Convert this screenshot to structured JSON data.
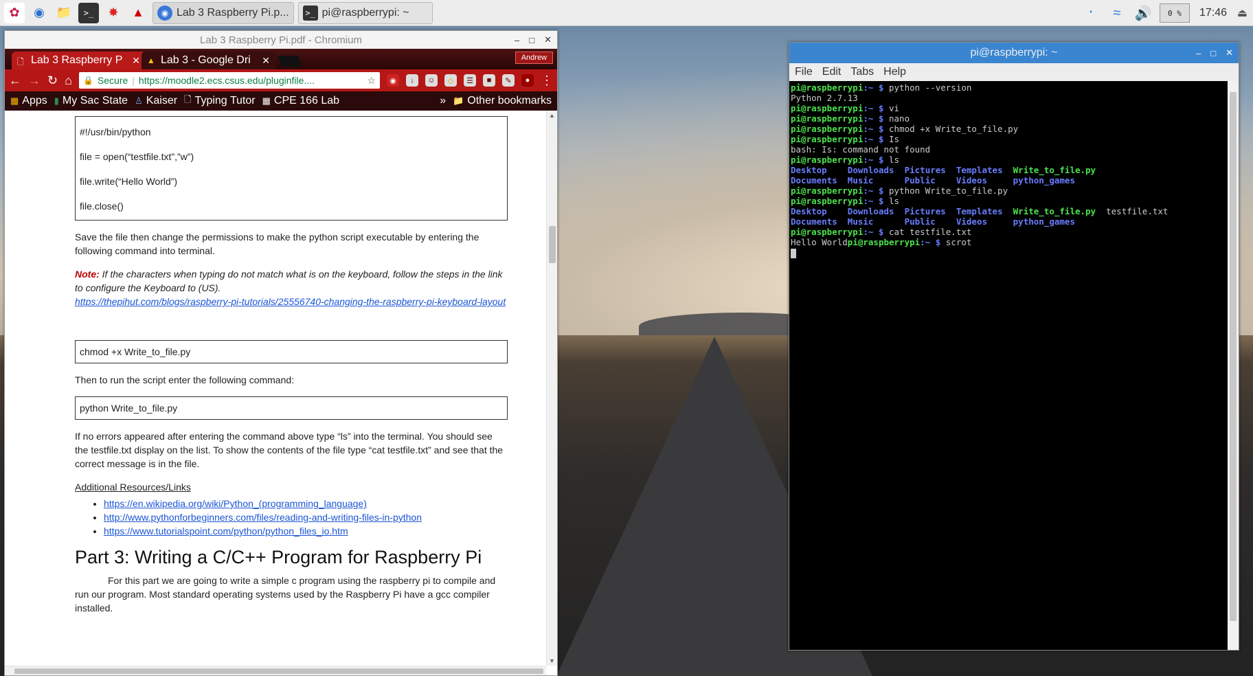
{
  "taskbar": {
    "launchers": [
      "raspberry-menu-icon",
      "web-browser-icon",
      "file-manager-icon",
      "terminal-icon",
      "mathematica-icon",
      "wolfram-icon"
    ],
    "tasks": [
      {
        "label": "Lab 3 Raspberry Pi.p...",
        "icon": "chromium-icon"
      },
      {
        "label": "pi@raspberrypi: ~",
        "icon": "terminal-icon"
      }
    ],
    "cpu": "0 %",
    "clock": "17:46"
  },
  "browser": {
    "title": "Lab 3 Raspberry Pi.pdf - Chromium",
    "tabs": [
      {
        "label": "Lab 3 Raspberry P",
        "active": true
      },
      {
        "label": "Lab 3 - Google Dri",
        "active": false
      }
    ],
    "profile": "Andrew",
    "secure_label": "Secure",
    "url": "https://moodle2.ecs.csus.edu/pluginfile....",
    "bookmarks": [
      {
        "label": "Apps"
      },
      {
        "label": "My Sac State"
      },
      {
        "label": "Kaiser"
      },
      {
        "label": "Typing Tutor"
      },
      {
        "label": "CPE 166 Lab"
      }
    ],
    "bookmarks_overflow": "»",
    "other_bookmarks": "Other bookmarks"
  },
  "doc": {
    "code_box_1": [
      "#!/usr/bin/python",
      "file = open(“testfile.txt”,”w”)",
      "file.write(“Hello World”)",
      "file.close()"
    ],
    "para_save": "Save the file then change the permissions to make the python script executable by entering the following command into terminal.",
    "note_label": "Note:",
    "note_text": " If the characters when typing do not match what is on the keyboard, follow the steps in the link to configure the Keyboard to (US).",
    "note_link": "https://thepihut.com/blogs/raspberry-pi-tutorials/25556740-changing-the-raspberry-pi-keyboard-layout",
    "code_chmod": "chmod +x Write_to_file.py",
    "para_run": "Then to run the script enter the following command:",
    "code_run": "python Write_to_file.py",
    "para_noerr": "If no errors appeared after entering the command above type “ls” into the terminal. You should see the testfile.txt display on the list. To show the contents of the file type “cat testfile.txt” and see that the correct message is in the file.",
    "resources_title": "Additional Resources/Links",
    "resources": [
      "https://en.wikipedia.org/wiki/Python_(programming_language)",
      "http://www.pythonforbeginners.com/files/reading-and-writing-files-in-python",
      "https://www.tutorialspoint.com/python/python_files_io.htm"
    ],
    "part3_title": "Part 3: Writing a C/C++ Program for Raspberry Pi",
    "part3_text": "For this part we are going to write a simple c program using the raspberry pi to compile and run our program. Most standard operating systems used by the Raspberry Pi have a gcc compiler installed."
  },
  "terminal": {
    "title": "pi@raspberrypi: ~",
    "menu": [
      "File",
      "Edit",
      "Tabs",
      "Help"
    ],
    "prompt_user": "pi@raspberrypi",
    "prompt_path": ":~ $ ",
    "lines": [
      {
        "type": "cmd",
        "text": "python --version"
      },
      {
        "type": "out",
        "text": "Python 2.7.13"
      },
      {
        "type": "cmd",
        "text": "vi"
      },
      {
        "type": "cmd",
        "text": "nano"
      },
      {
        "type": "cmd",
        "text": "chmod +x Write_to_file.py"
      },
      {
        "type": "cmd",
        "text": "Is"
      },
      {
        "type": "out",
        "text": "bash: Is: command not found"
      },
      {
        "type": "cmd",
        "text": "ls"
      },
      {
        "type": "ls",
        "items": [
          [
            "Desktop",
            "dir"
          ],
          [
            "Downloads",
            "dir"
          ],
          [
            "Pictures",
            "dir"
          ],
          [
            "Templates",
            "dir"
          ],
          [
            "Write_to_file.py",
            "exe"
          ]
        ]
      },
      {
        "type": "ls",
        "items": [
          [
            "Documents",
            "dir"
          ],
          [
            "Music",
            "dir"
          ],
          [
            "Public",
            "dir"
          ],
          [
            "Videos",
            "dir"
          ],
          [
            "python_games",
            "dir"
          ]
        ]
      },
      {
        "type": "cmd",
        "text": "python Write_to_file.py"
      },
      {
        "type": "cmd",
        "text": "ls"
      },
      {
        "type": "ls",
        "items": [
          [
            "Desktop",
            "dir"
          ],
          [
            "Downloads",
            "dir"
          ],
          [
            "Pictures",
            "dir"
          ],
          [
            "Templates",
            "dir"
          ],
          [
            "Write_to_file.py",
            "exe"
          ],
          [
            "testfile.txt",
            "out"
          ]
        ]
      },
      {
        "type": "ls",
        "items": [
          [
            "Documents",
            "dir"
          ],
          [
            "Music",
            "dir"
          ],
          [
            "Public",
            "dir"
          ],
          [
            "Videos",
            "dir"
          ],
          [
            "python_games",
            "dir"
          ]
        ]
      },
      {
        "type": "cmd",
        "text": "cat testfile.txt"
      },
      {
        "type": "catcmd",
        "out": "Hello World",
        "text": "scrot"
      }
    ]
  },
  "colors": {
    "chrome_red": "#b51616",
    "term_title": "#3a85cf",
    "prompt_green": "#4ce34c",
    "dir_blue": "#6a7cff"
  }
}
